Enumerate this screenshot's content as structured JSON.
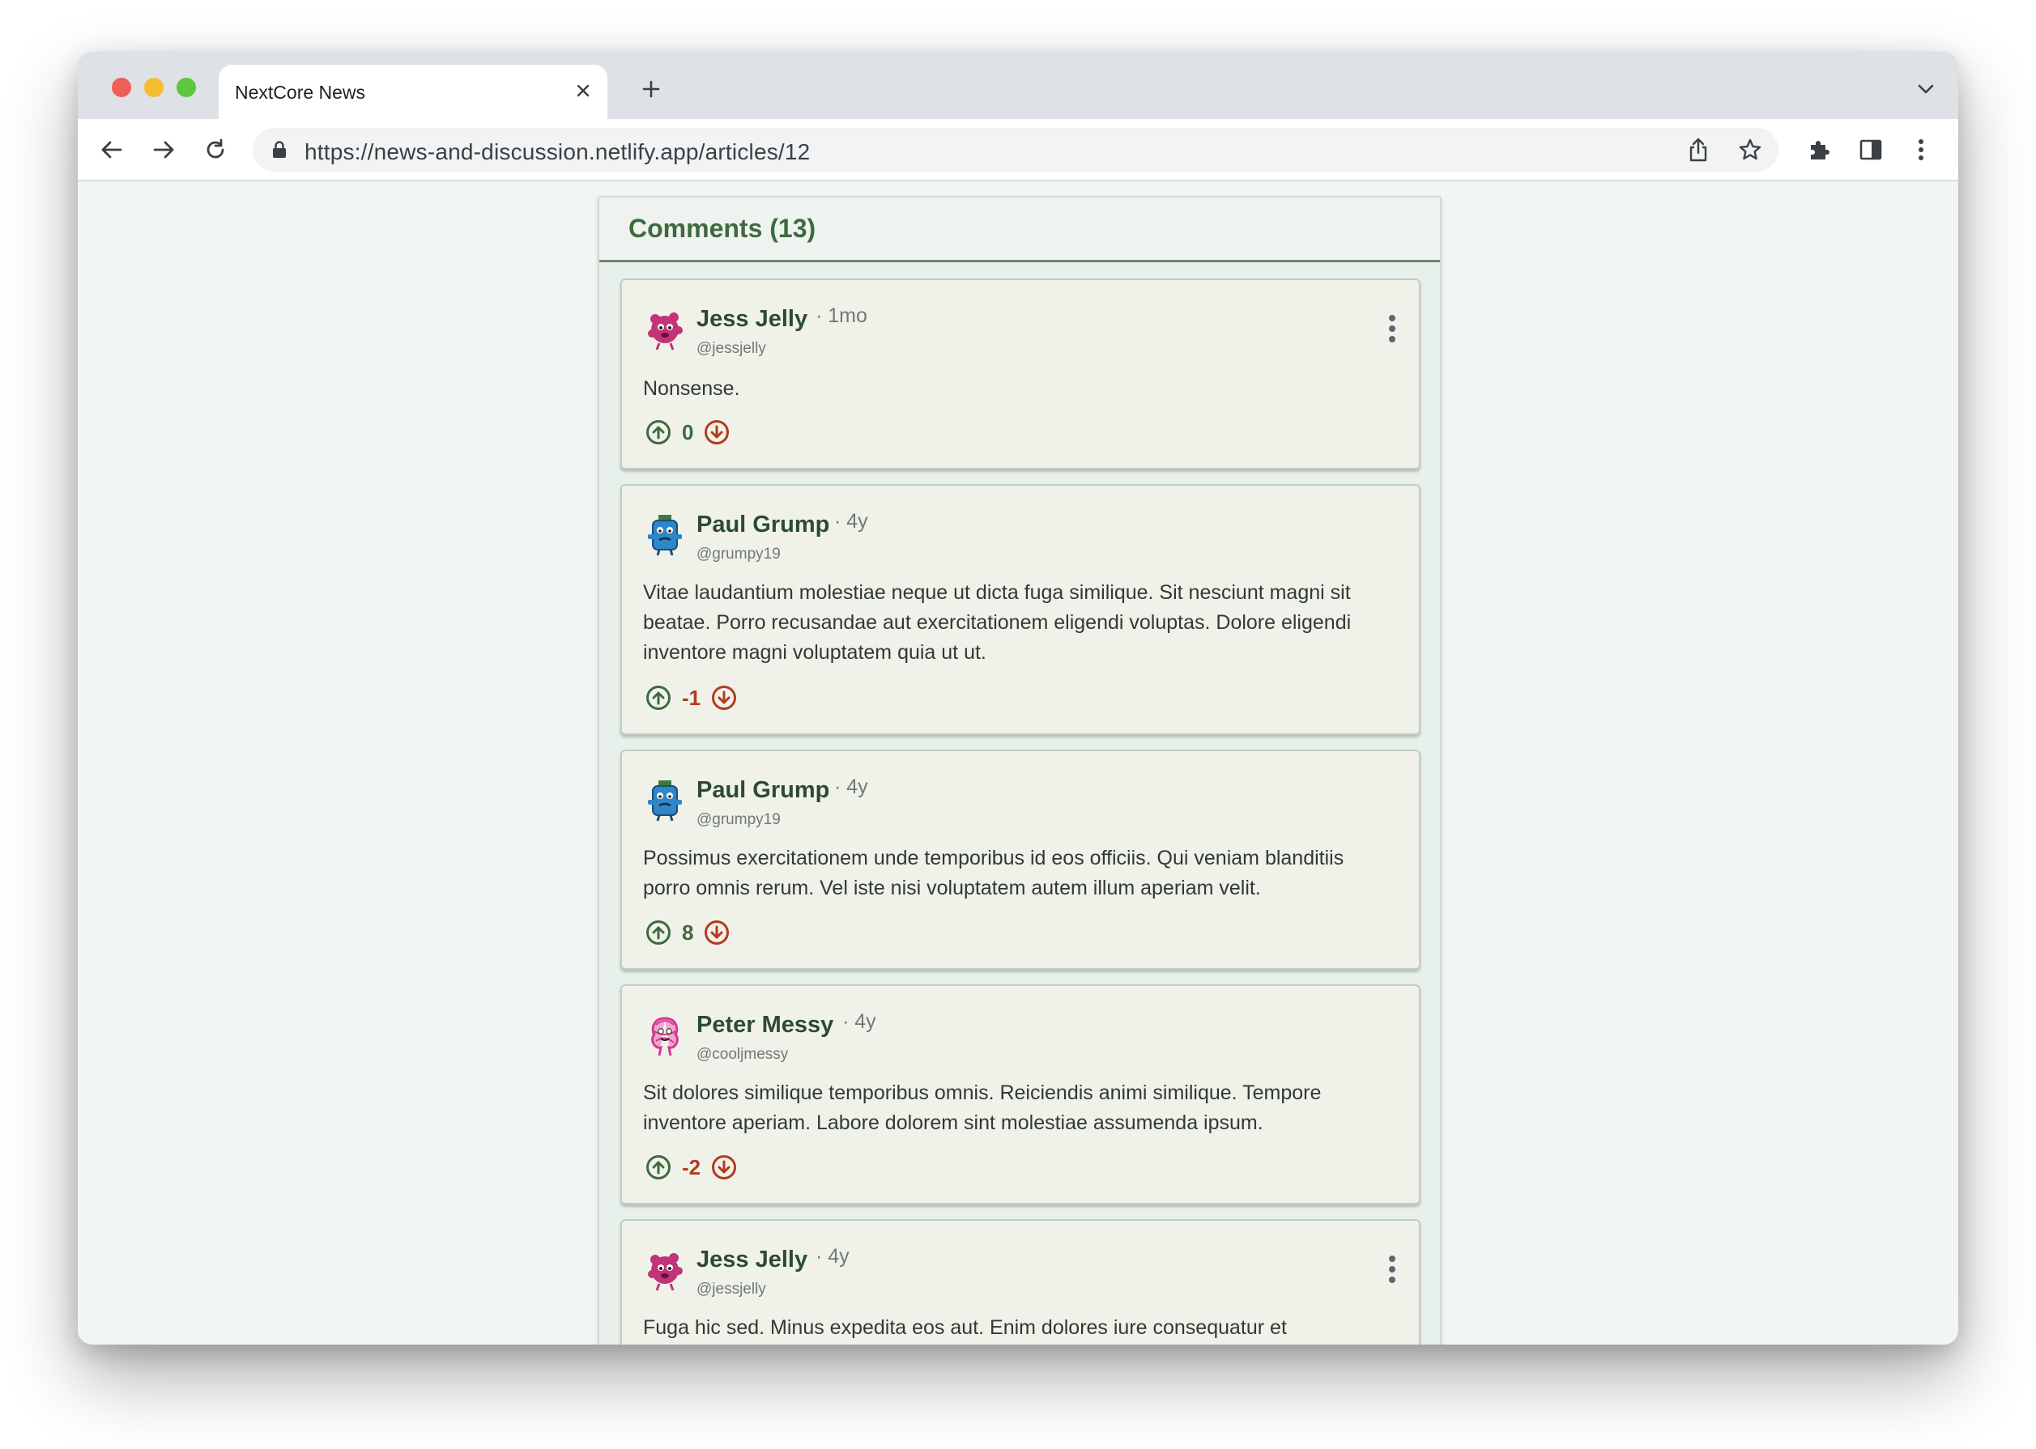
{
  "browser": {
    "tab_title": "NextCore News",
    "url": "https://news-and-discussion.netlify.app/articles/12"
  },
  "colors": {
    "accent_green": "#3f6a3f",
    "downvote_red": "#b23b1f",
    "page_bg": "#f1f6f3"
  },
  "comments_section": {
    "title": "Comments (13)",
    "comments": [
      {
        "author": "Jess Jelly",
        "time": "· 1mo",
        "handle": "@jessjelly",
        "body": "Nonsense.",
        "score": "0",
        "avatar_icon": "pink-character-avatar-icon",
        "has_menu": true
      },
      {
        "author": "Paul Grump",
        "time": "· 4y",
        "handle": "@grumpy19",
        "body": "Vitae laudantium molestiae neque ut dicta fuga similique. Sit nesciunt magni sit beatae. Porro recusandae aut exercitationem eligendi voluptas. Dolore eligendi inventore magni voluptatem quia ut ut.",
        "score": "-1",
        "avatar_icon": "blue-character-avatar-icon",
        "has_menu": false
      },
      {
        "author": "Paul Grump",
        "time": "· 4y",
        "handle": "@grumpy19",
        "body": "Possimus exercitationem unde temporibus id eos officiis. Qui veniam blanditiis porro omnis rerum. Vel iste nisi voluptatem autem illum aperiam velit.",
        "score": "8",
        "avatar_icon": "blue-character-avatar-icon",
        "has_menu": false
      },
      {
        "author": "Peter Messy",
        "time": "· 4y",
        "handle": "@cooljmessy",
        "body": "Sit dolores similique temporibus omnis. Reiciendis animi similique. Tempore inventore aperiam. Labore dolorem sint molestiae assumenda ipsum.",
        "score": "-2",
        "avatar_icon": "scribble-character-avatar-icon",
        "has_menu": false
      },
      {
        "author": "Jess Jelly",
        "time": "· 4y",
        "handle": "@jessjelly",
        "body": "Fuga hic sed. Minus expedita eos aut. Enim dolores iure consequatur et",
        "score": "",
        "avatar_icon": "pink-character-avatar-icon",
        "has_menu": true
      }
    ]
  }
}
